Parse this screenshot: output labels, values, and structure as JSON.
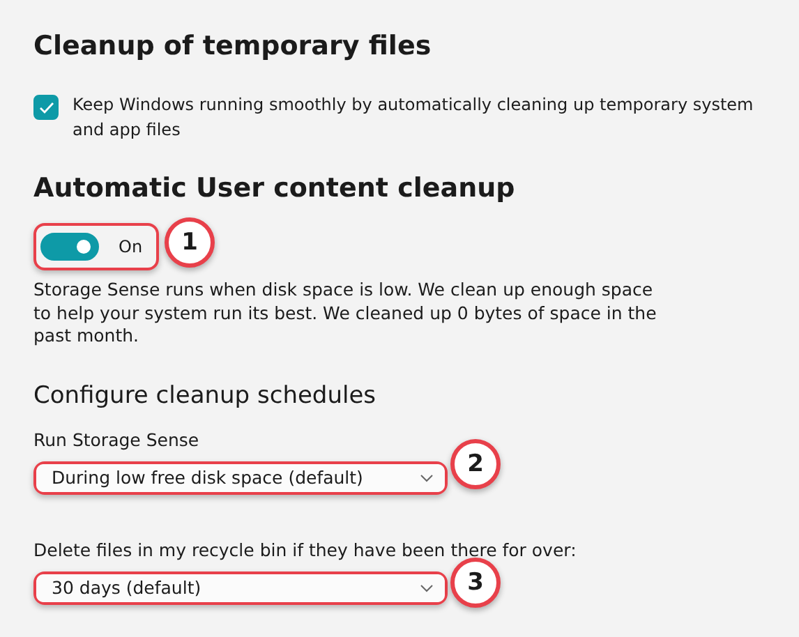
{
  "sections": [
    {
      "kind": "checkbox_section",
      "title": "Cleanup of temporary files",
      "checkbox": {
        "label": "Keep Windows running smoothly by automatically cleaning up temporary system and app files",
        "checked": true
      }
    },
    {
      "kind": "toggle_section",
      "title": "Automatic User content cleanup",
      "toggle": {
        "on": true,
        "label": "On",
        "callout": "1"
      },
      "description": "Storage Sense runs when disk space is low. We clean up enough space to help your system run its best. We cleaned up 0 bytes of space in the past month."
    },
    {
      "kind": "schedule_section",
      "title": "Configure cleanup schedules",
      "dropdowns": [
        {
          "label": "Run Storage Sense",
          "value": "During low free disk space (default)",
          "callout": "2"
        },
        {
          "label": "Delete files in my recycle bin if they have been there for over:",
          "value": "30 days (default)",
          "callout": "3"
        }
      ]
    }
  ]
}
